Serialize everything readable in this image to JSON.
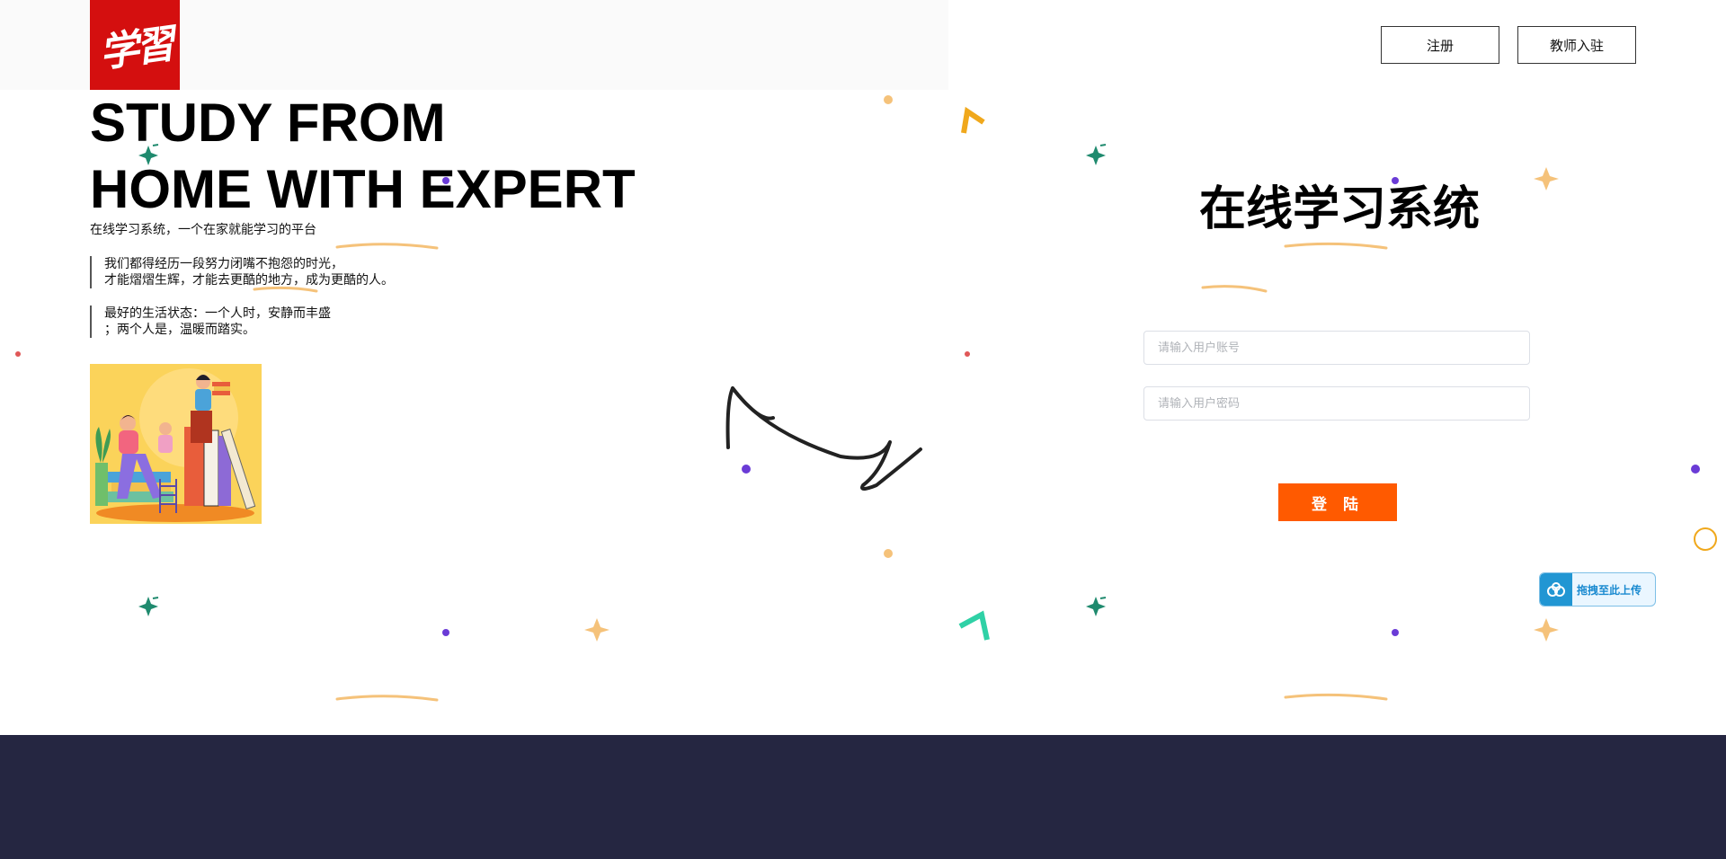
{
  "header": {
    "logo_text": "学習",
    "register_label": "注册",
    "teacher_join_label": "教师入驻"
  },
  "hero": {
    "title_line1": "STUDY FROM",
    "title_line2": "HOME WITH EXPERT",
    "tagline": "在线学习系统，一个在家就能学习的平台",
    "quote1_line1": "我们都得经历一段努力闭嘴不抱怨的时光，",
    "quote1_line2": "才能熠熠生辉，才能去更酷的地方，成为更酷的人。",
    "quote2_line1": "最好的生活状态：一个人时，安静而丰盛",
    "quote2_line2": "；两个人是，温暖而踏实。"
  },
  "login": {
    "title": "在线学习系统",
    "username_placeholder": "请输入用户账号",
    "password_placeholder": "请输入用户密码",
    "submit_label": "登 陆"
  },
  "upload_widget": {
    "label": "拖拽至此上传",
    "icon": "cloud-upload-icon"
  },
  "colors": {
    "accent": "#ff5a00",
    "logo_red": "#d40f0f",
    "footer": "#252641",
    "teal": "#1f8a6e",
    "purple": "#6a3bd6",
    "gold": "#f5c27a"
  }
}
